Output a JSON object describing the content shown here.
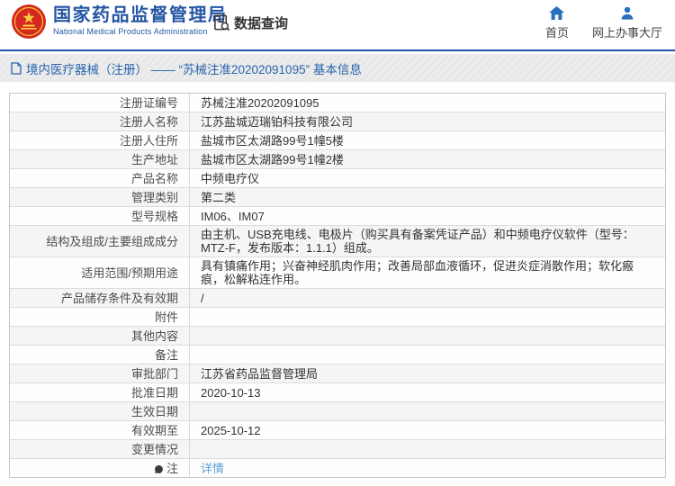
{
  "header": {
    "logo": {
      "title_cn": "国家药品监督管理局",
      "title_en": "National Medical Products Administration"
    },
    "section_label": "数据查询",
    "nav": [
      {
        "label": "首页"
      },
      {
        "label": "网上办事大厅"
      }
    ]
  },
  "breadcrumb": {
    "text": "境内医疗器械（注册） —— “苏械注准20202091095” 基本信息"
  },
  "table": {
    "rows": [
      {
        "label": "注册证编号",
        "value": "苏械注准20202091095"
      },
      {
        "label": "注册人名称",
        "value": "江苏盐城迈瑞铂科技有限公司"
      },
      {
        "label": "注册人住所",
        "value": "盐城市区太湖路99号1幢5楼"
      },
      {
        "label": "生产地址",
        "value": "盐城市区太湖路99号1幢2楼"
      },
      {
        "label": "产品名称",
        "value": "中频电疗仪"
      },
      {
        "label": "管理类别",
        "value": "第二类"
      },
      {
        "label": "型号规格",
        "value": "IM06、IM07"
      },
      {
        "label": "结构及组成/主要组成成分",
        "value": "由主机、USB充电线、电极片（购买具有备案凭证产品）和中频电疗仪软件（型号：MTZ-F，发布版本：1.1.1）组成。"
      },
      {
        "label": "适用范围/预期用途",
        "value": "具有镇痛作用；兴奋神经肌肉作用；改善局部血液循环，促进炎症消散作用；软化瘢痕，松解粘连作用。"
      },
      {
        "label": "产品储存条件及有效期",
        "value": "/"
      },
      {
        "label": "附件",
        "value": ""
      },
      {
        "label": "其他内容",
        "value": ""
      },
      {
        "label": "备注",
        "value": ""
      },
      {
        "label": "审批部门",
        "value": "江苏省药品监督管理局"
      },
      {
        "label": "批准日期",
        "value": "2020-10-13"
      },
      {
        "label": "生效日期",
        "value": ""
      },
      {
        "label": "有效期至",
        "value": "2025-10-12"
      },
      {
        "label": "变更情况",
        "value": ""
      },
      {
        "label": "注",
        "value": "详情"
      }
    ]
  },
  "colors": {
    "brand_blue": "#2456a4",
    "nav_icon_blue": "#2a6ebb",
    "header_rule_blue": "#1f55a5",
    "breadcrumb_blue": "#2a64ad",
    "link_blue": "#5b9bd5",
    "emblem_red": "#d5281e",
    "row_alt_gray": "#f5f5f5"
  }
}
